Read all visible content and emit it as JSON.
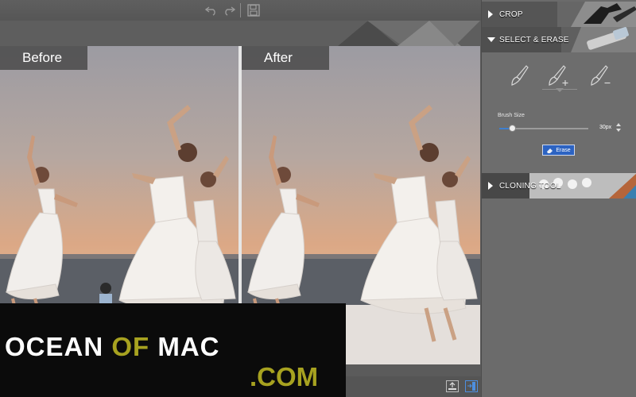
{
  "toolbar": {
    "undo_icon": "undo-icon",
    "redo_icon": "redo-icon",
    "save_icon": "save-icon"
  },
  "compare": {
    "before_label": "Before",
    "after_label": "After"
  },
  "panel": {
    "sections": [
      {
        "label": "CROP",
        "expanded": false
      },
      {
        "label": "SELECT & ERASE",
        "expanded": true
      },
      {
        "label": "CLONING TOOL",
        "expanded": false
      }
    ],
    "tools": [
      "brush-icon",
      "brush-add-icon",
      "brush-subtract-icon"
    ],
    "brush_size_label": "Brush Size",
    "brush_size_value": "30px",
    "brush_size_fraction": 0.14,
    "erase_label": "Erase"
  },
  "statusbar": {
    "icons": [
      "export-icon",
      "toggle-panel-icon"
    ]
  },
  "watermark": {
    "part1": "OCEAN",
    "part2": "OF",
    "part3": "MAC",
    "line2": ".COM"
  },
  "colors": {
    "accent_blue": "#2c63c2",
    "watermark_olive": "#a7a220"
  }
}
